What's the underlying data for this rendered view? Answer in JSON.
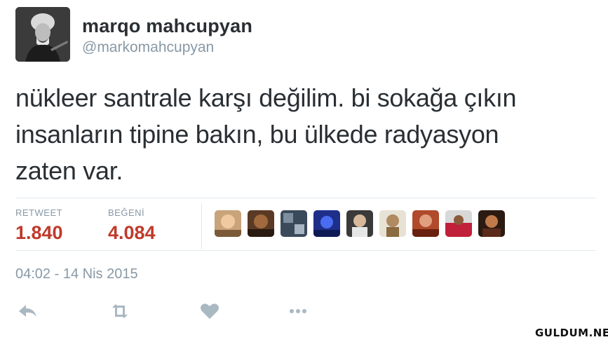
{
  "tweet": {
    "display_name": "marqo mahcupyan",
    "handle": "@markomahcupyan",
    "text_lines": [
      "nükleer santrale karşı değilim. bi sokağa çıkın",
      "insanların tipine bakın, bu ülkede radyasyon",
      "zaten var."
    ],
    "avatar_icon": "portrait-avatar"
  },
  "stats": {
    "retweet_label": "RETWEET",
    "retweet_count": "1.840",
    "like_label": "BEĞENİ",
    "like_count": "4.084"
  },
  "likers": {
    "count_shown": 9
  },
  "timestamp": "04:02 - 14 Nis 2015",
  "actions": [
    {
      "name": "reply",
      "icon": "reply-icon"
    },
    {
      "name": "retweet",
      "icon": "retweet-icon"
    },
    {
      "name": "like",
      "icon": "heart-icon"
    },
    {
      "name": "more",
      "icon": "more-icon"
    }
  ],
  "watermark": "GULDUM.NET",
  "colors": {
    "count": "#c0392b",
    "muted": "#8899a6",
    "text": "#292f33",
    "divider": "#e1e8ed"
  }
}
